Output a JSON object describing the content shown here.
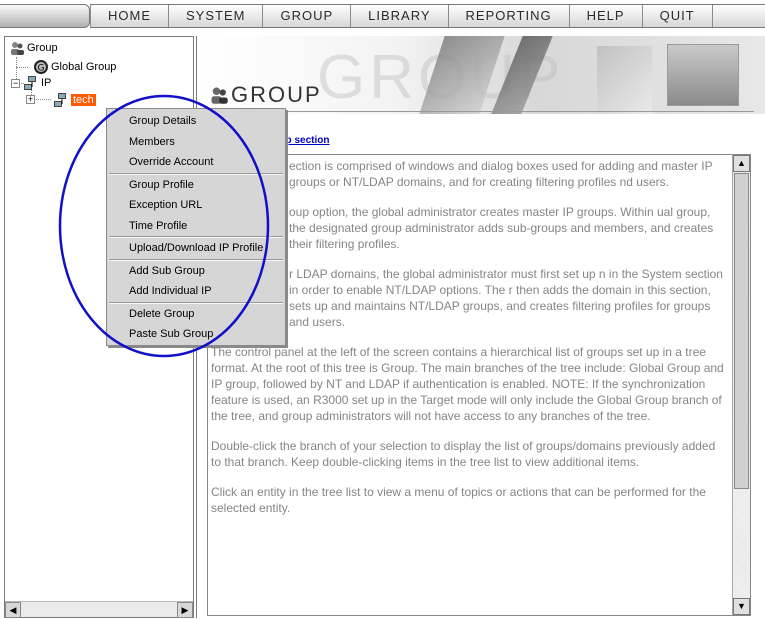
{
  "nav": {
    "items": [
      "HOME",
      "SYSTEM",
      "GROUP",
      "LIBRARY",
      "REPORTING",
      "HELP",
      "QUIT"
    ]
  },
  "tree": {
    "root": "Group",
    "global_group": "Global Group",
    "ip": "IP",
    "selected_child": "tech",
    "expander_collapsed": "+",
    "expander_expanded": "−"
  },
  "scrollbar": {
    "left_arrow": "◀",
    "right_arrow": "▶",
    "up_arrow": "▲",
    "down_arrow": "▼"
  },
  "main": {
    "banner_ghost": "GROUP",
    "page_title": "GROUP",
    "topics_link": "pics for the Group section",
    "paragraphs": [
      "ection is comprised of windows and dialog boxes used for adding and master IP groups or NT/LDAP domains, and for creating filtering profiles nd users.",
      "oup option, the global administrator creates master IP groups. Within ual group, the designated group administrator adds sub-groups and members, and creates their filtering profiles.",
      "r LDAP domains, the global administrator must first set up n in the System section in order to enable NT/LDAP options. The r then adds the domain in this section, sets up and maintains NT/LDAP groups, and creates filtering profiles for groups and users.",
      "The control panel at the left of the screen contains a hierarchical list of groups set up in a tree format. At the root of this tree is Group. The main branches of the tree include: Global Group and IP group, followed by NT and LDAP if authentication is enabled. NOTE: If the synchronization feature is used, an R3000 set up in the Target mode will only include the Global Group branch of the tree, and group administrators will not have access to any branches of the tree.",
      "Double-click the branch of your selection to display the list of groups/domains previously added to that branch. Keep double-clicking items in the tree list to view additional items.",
      "Click an entity in the tree list to view a menu of topics or actions that can be performed for the selected entity."
    ]
  },
  "context_menu": {
    "group1": [
      "Group Details",
      "Members",
      "Override Account"
    ],
    "group2": [
      "Group Profile",
      "Exception URL",
      "Time Profile"
    ],
    "group3": [
      "Upload/Download IP Profile"
    ],
    "group4": [
      "Add Sub Group",
      "Add Individual IP"
    ],
    "group5": [
      "Delete Group",
      "Paste Sub Group"
    ]
  },
  "colors": {
    "selection": "#ff5a00",
    "annotation": "#1010c8",
    "link": "#0000cc"
  }
}
